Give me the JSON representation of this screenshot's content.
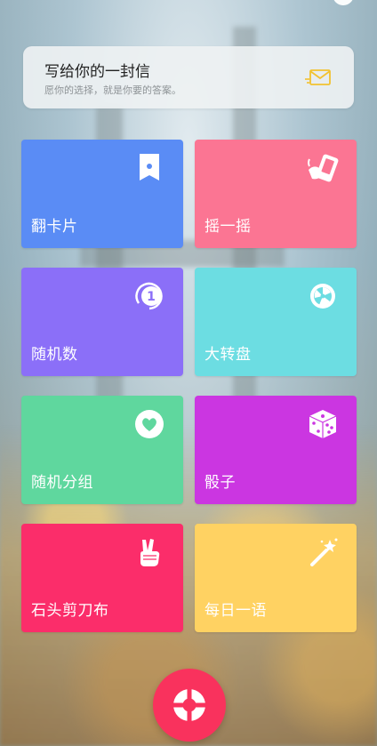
{
  "letter": {
    "title": "写给你的一封信",
    "subtitle": "愿你的选择，就是你要的答案。",
    "icon": "envelope-icon",
    "icon_color": "#f2c230"
  },
  "tiles": [
    {
      "label": "翻卡片",
      "color": "#5a8cf5",
      "icon": "card-bookmark-icon"
    },
    {
      "label": "摇一摇",
      "color": "#fb7593",
      "icon": "phone-shake-icon"
    },
    {
      "label": "随机数",
      "color": "#8b6ff8",
      "icon": "number-one-icon",
      "icon_text": "1"
    },
    {
      "label": "大转盘",
      "color": "#6cdde2",
      "icon": "spinning-wheel-icon"
    },
    {
      "label": "随机分组",
      "color": "#5fd79e",
      "icon": "heart-icon"
    },
    {
      "label": "骰子",
      "color": "#cb36e1",
      "icon": "dice-icon"
    },
    {
      "label": "石头剪刀布",
      "color": "#fb2d6a",
      "icon": "victory-hand-icon"
    },
    {
      "label": "每日一语",
      "color": "#ffd262",
      "icon": "magic-wand-icon"
    }
  ],
  "fab": {
    "icon": "lifebuoy-icon",
    "color": "#f9325d"
  }
}
